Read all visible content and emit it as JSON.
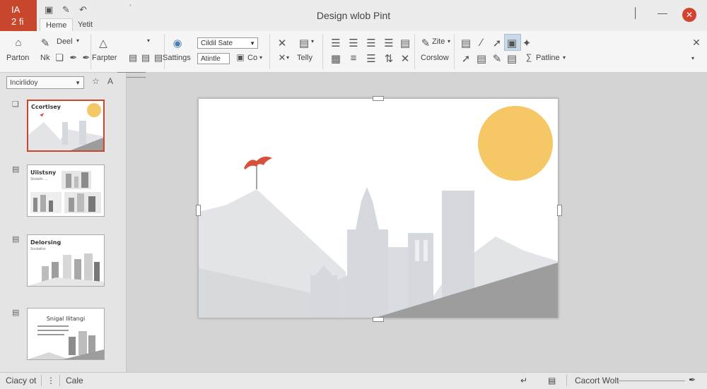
{
  "app_badge": {
    "line1": "IA",
    "line2": "2 fi"
  },
  "window_title": "Design wlob Pint",
  "tabs": [
    "Heme",
    "Yetit"
  ],
  "ribbon": {
    "labels": {
      "partion": "Parton",
      "nk": "Nk",
      "deel": "Deel",
      "farpter": "Farpter",
      "sattings": "Sattings",
      "font_name": "Cildil Sate",
      "font_size": "Atintle",
      "co": "Co",
      "telly": "Telly",
      "zite": "Zite",
      "corslow": "Corslow",
      "patline": "Patline"
    }
  },
  "left_pane": {
    "dropdown": "Incirlidoy",
    "thumbnails": [
      {
        "title": "Ccortisey",
        "sub": ""
      },
      {
        "title": "Uiistsny",
        "sub": "Skstalin ...."
      },
      {
        "title": "Delorsing",
        "sub": "Srsstalins"
      },
      {
        "title": "Snigal Ilitangi",
        "sub": ""
      }
    ]
  },
  "status": {
    "left1": "Ciacy ot",
    "left2": "Cale",
    "right_label": "Cacort Wolt"
  },
  "colors": {
    "accent": "#c8462c",
    "sun": "#f6c765",
    "flag": "#d5513b",
    "mountain_light": "#e2e4e7",
    "building": "#d5d8dc",
    "ground_dark": "#9d9d9d"
  }
}
